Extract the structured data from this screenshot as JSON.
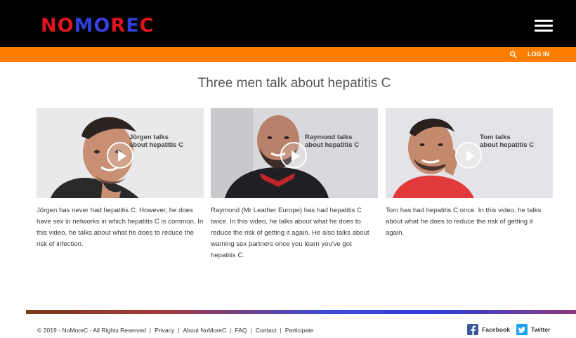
{
  "header": {
    "logo_text": "NOMOREC",
    "logo_letters": [
      "N",
      "O",
      "M",
      "O",
      "R",
      "E",
      "C"
    ],
    "menu_icon": "hamburger-icon"
  },
  "utility_bar": {
    "search_icon": "search-icon",
    "login_label": "LOG IN"
  },
  "main": {
    "heading": "Three men talk about hepatitis C",
    "videos": [
      {
        "overlay_line1": "Jörgen talks",
        "overlay_line2": "about hepatitis C",
        "description": "Jörgen has never had hepatitis C. However, he does have sex in networks in which hepatitis C is common. In this video, he talks about what he does to reduce the risk of infection."
      },
      {
        "overlay_line1": "Raymond talks",
        "overlay_line2": "about hepatitis C",
        "description": "Raymond (Mr Leather Europe) has had hepatitis C twice. In this video, he talks about what he does to reduce the risk of getting it again. He also talks about warning sex partners once you learn you've got hepatitis C."
      },
      {
        "overlay_line1": "Tom talks",
        "overlay_line2": "about hepatitis C",
        "description": "Tom has had hepatitis C once. In this video, he talks about what he does to reduce the risk of getting it again."
      }
    ]
  },
  "footer": {
    "copyright": "© 2019 - NoMoreC - All Rights Reserved",
    "links": [
      "Privacy",
      "About NoMoreC",
      "FAQ",
      "Contact",
      "Participate"
    ],
    "facebook_label": "Facebook",
    "twitter_label": "Twitter"
  },
  "colors": {
    "topbar": "#000000",
    "accent_orange": "#ff7e00",
    "logo_red": "#e0141e",
    "logo_blue": "#2f3fd8",
    "facebook": "#3b5998",
    "twitter": "#1da1f2"
  }
}
